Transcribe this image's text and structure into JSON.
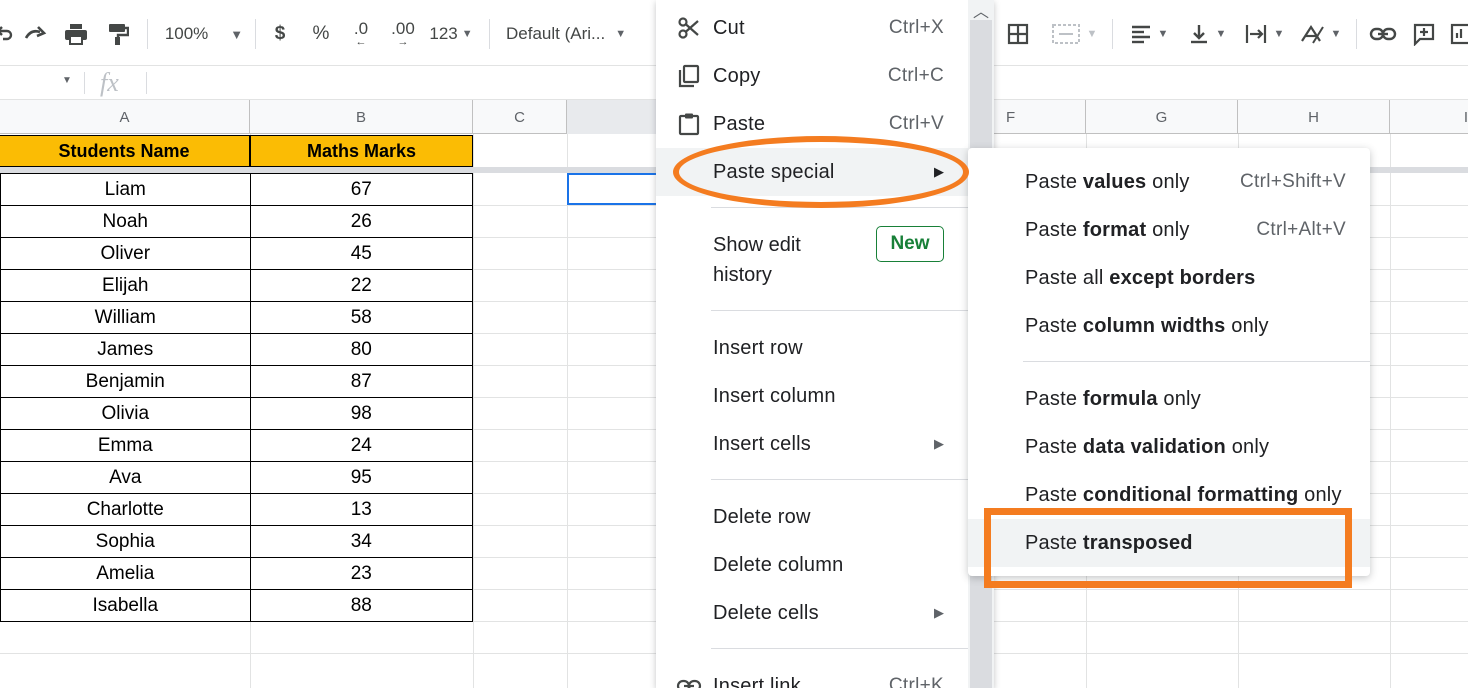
{
  "toolbar": {
    "zoom": "100%",
    "currency": "$",
    "percent": "%",
    "decrease_decimal": ".0",
    "increase_decimal": ".00",
    "number_format": "123",
    "font": "Default (Ari..."
  },
  "formula_bar": {
    "fx": "fx"
  },
  "columns": [
    "A",
    "B",
    "C",
    "F",
    "G",
    "H",
    "I"
  ],
  "table": {
    "header_name": "Students Name",
    "header_marks": "Maths Marks",
    "rows": [
      {
        "name": "Liam",
        "mark": "67"
      },
      {
        "name": "Noah",
        "mark": "26"
      },
      {
        "name": "Oliver",
        "mark": "45"
      },
      {
        "name": "Elijah",
        "mark": "22"
      },
      {
        "name": "William",
        "mark": "58"
      },
      {
        "name": "James",
        "mark": "80"
      },
      {
        "name": "Benjamin",
        "mark": "87"
      },
      {
        "name": "Olivia",
        "mark": "98"
      },
      {
        "name": "Emma",
        "mark": "24"
      },
      {
        "name": "Ava",
        "mark": "95"
      },
      {
        "name": "Charlotte",
        "mark": "13"
      },
      {
        "name": "Sophia",
        "mark": "34"
      },
      {
        "name": "Amelia",
        "mark": "23"
      },
      {
        "name": "Isabella",
        "mark": "88"
      }
    ]
  },
  "menu": {
    "cut": "Cut",
    "cut_sc": "Ctrl+X",
    "copy": "Copy",
    "copy_sc": "Ctrl+C",
    "paste": "Paste",
    "paste_sc": "Ctrl+V",
    "paste_special": "Paste special",
    "show_edit_history": "Show edit history",
    "new_badge": "New",
    "insert_row": "Insert row",
    "insert_column": "Insert column",
    "insert_cells": "Insert cells",
    "delete_row": "Delete row",
    "delete_column": "Delete column",
    "delete_cells": "Delete cells",
    "insert_link": "Insert link",
    "insert_link_sc": "Ctrl+K"
  },
  "submenu": {
    "values": {
      "pre": "Paste ",
      "bold": "values",
      "post": " only",
      "sc": "Ctrl+Shift+V"
    },
    "format": {
      "pre": "Paste ",
      "bold": "format",
      "post": " only",
      "sc": "Ctrl+Alt+V"
    },
    "except_borders": {
      "pre": "Paste all ",
      "bold": "except borders",
      "post": ""
    },
    "column_widths": {
      "pre": "Paste ",
      "bold": "column widths",
      "post": " only"
    },
    "formula": {
      "pre": "Paste ",
      "bold": "formula",
      "post": " only"
    },
    "data_validation": {
      "pre": "Paste ",
      "bold": "data validation",
      "post": " only"
    },
    "conditional_formatting": {
      "pre": "Paste ",
      "bold": "conditional formatting",
      "post": " only"
    },
    "transposed": {
      "pre": "Paste ",
      "bold": "transposed",
      "post": ""
    }
  },
  "colors": {
    "header_fill": "#fbbc04",
    "highlight": "#f47c20",
    "badge": "#188038",
    "selection": "#1a73e8"
  }
}
